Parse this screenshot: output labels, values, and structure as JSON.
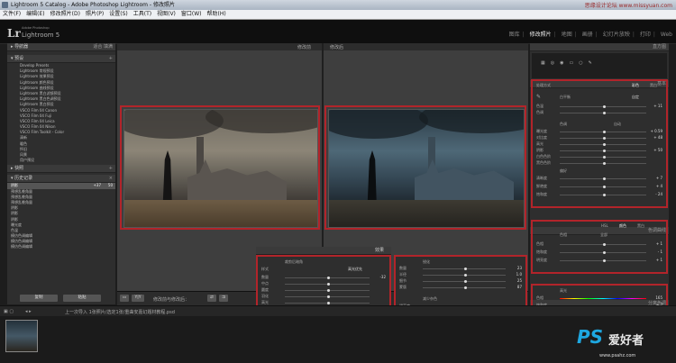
{
  "window": {
    "title": "Lightroom 5 Catalog - Adobe Photoshop Lightroom - 修改照片"
  },
  "menu": [
    "文件(F)",
    "编辑(E)",
    "修改照片(D)",
    "照片(P)",
    "设置(S)",
    "工具(T)",
    "视图(V)",
    "窗口(W)",
    "帮助(H)"
  ],
  "watermark_top": "思缘设计论坛 www.missyuan.com",
  "identity": {
    "logo": "Lr",
    "sub1": "Adobe Photoshop",
    "sub2": "Lightroom 5"
  },
  "modules": [
    "图库",
    "修改照片",
    "地图",
    "画册",
    "幻灯片放映",
    "打印",
    "Web"
  ],
  "left": {
    "navigator": {
      "title": "导航器",
      "options": [
        "适合",
        "填满"
      ]
    },
    "presets": {
      "title": "预设",
      "items": [
        "Develop Presets",
        "Lightroom 常规预设",
        "Lightroom 效果预设",
        "Lightroom 颜色预设",
        "Lightroom 曲线预设",
        "Lightroom 黑白滤镜预设",
        "Lightroom 黑白色调预设",
        "Lightroom 黑白预设",
        "VSCO Film 04 Canon",
        "VSCO Film 04 Fuji",
        "VSCO Film 04 Leica",
        "VSCO Film 04 Nikon",
        "VSCO Film Toolkit - Color",
        "清新",
        "暖色",
        "怀旧",
        "风景",
        "用户预设"
      ]
    },
    "snapshots": {
      "title": "快照"
    },
    "history": {
      "title": "历史记录",
      "items": [
        {
          "label": "阴影",
          "a": "+37",
          "b": "50"
        },
        {
          "label": "预想乱晚角量",
          "a": "",
          "b": ""
        },
        {
          "label": "预想乱晚角量",
          "a": "",
          "b": ""
        },
        {
          "label": "预想乱晚角量",
          "a": "",
          "b": ""
        },
        {
          "label": "阴影",
          "a": "",
          "b": ""
        },
        {
          "label": "阴影",
          "a": "",
          "b": ""
        },
        {
          "label": "阴影",
          "a": "",
          "b": ""
        },
        {
          "label": "曝光度",
          "a": "",
          "b": ""
        },
        {
          "label": "色温",
          "a": "",
          "b": ""
        },
        {
          "label": "模仿色调编辑",
          "a": "",
          "b": ""
        },
        {
          "label": "模仿色调编辑",
          "a": "",
          "b": ""
        },
        {
          "label": "模仿色调编辑",
          "a": "",
          "b": ""
        }
      ]
    },
    "copy_button": "复制",
    "paste_button": "粘贴"
  },
  "center": {
    "before_label": "修改前",
    "after_label": "修改后"
  },
  "toolbar": {
    "yy": "Y|Y",
    "mode": "修改前与修改后："
  },
  "effects": {
    "title": "效果",
    "vignette": {
      "section": "裁剪后暗角",
      "style_label": "样式",
      "style_value": "高光优先",
      "sliders": [
        {
          "label": "数量",
          "value": "-32"
        },
        {
          "label": "中点",
          "value": ""
        },
        {
          "label": "圆度",
          "value": ""
        },
        {
          "label": "羽化",
          "value": ""
        },
        {
          "label": "高光",
          "value": ""
        }
      ]
    },
    "grain": {
      "section": "颗粒",
      "sliders": [
        {
          "label": "数量",
          "value": ""
        },
        {
          "label": "大小",
          "value": ""
        },
        {
          "label": "粗糙度",
          "value": ""
        }
      ]
    },
    "footer": "细节控制"
  },
  "detail": {
    "sharpen": {
      "section": "锐化",
      "sliders": [
        {
          "label": "数量",
          "value": "23"
        },
        {
          "label": "半径",
          "value": "1.0"
        },
        {
          "label": "细节",
          "value": "25"
        },
        {
          "label": "蒙版",
          "value": "87"
        }
      ]
    },
    "noise": {
      "section": "减少杂色",
      "sliders": [
        {
          "label": "明亮度",
          "value": ""
        },
        {
          "label": "细节",
          "value": ""
        },
        {
          "label": "对比度",
          "value": ""
        },
        {
          "label": "颜色",
          "value": ""
        },
        {
          "label": "细节",
          "value": ""
        }
      ]
    },
    "footer": "镜头校正"
  },
  "right": {
    "histogram": "直方图",
    "basic": {
      "title": "基本",
      "treatment_label": "处理方式",
      "treatment_options": [
        "彩色",
        "黑白"
      ],
      "wb_label": "白平衡",
      "wb_value": "自定",
      "wb_sliders": [
        {
          "label": "色温",
          "value": "+ 11"
        },
        {
          "label": "色调",
          "value": ""
        }
      ],
      "tone_title": "色调",
      "tone_auto": "自动",
      "tone_sliders": [
        {
          "label": "曝光度",
          "value": "+ 0.59"
        },
        {
          "label": "对比度",
          "value": "+ 48"
        },
        {
          "label": "高光",
          "value": ""
        },
        {
          "label": "阴影",
          "value": "+ 50"
        },
        {
          "label": "白色色阶",
          "value": ""
        },
        {
          "label": "黑色色阶",
          "value": ""
        }
      ],
      "presence_title": "偏好",
      "presence_sliders": [
        {
          "label": "清晰度",
          "value": "+ 7"
        },
        {
          "label": "鲜艳度",
          "value": "+ 4"
        },
        {
          "label": "饱和度",
          "value": "- 24"
        }
      ]
    },
    "curve": "色调曲线",
    "hsl": {
      "tabs": [
        "HSL",
        "颜色",
        "黑白"
      ],
      "sub": "色相",
      "sub2": "饱和度",
      "sub3": "明亮度",
      "all": "全部",
      "sliders": [
        {
          "label": "色相",
          "value": "+ 1"
        },
        {
          "label": "饱和度",
          "value": "- 1"
        },
        {
          "label": "明亮度",
          "value": "+ 1"
        }
      ]
    },
    "split": {
      "title": "分离色调",
      "highlight": "高光",
      "hue": "色相",
      "hue_val": "165",
      "sat": "饱和度",
      "sat_val": "+ 7",
      "balance": "平衡",
      "shadows": "阴影",
      "shadow_hue": "色相",
      "shadow_hue_val": "none"
    }
  },
  "filmstrip": {
    "nav": "上一次导入 1张照片/选定1张/重曲安嘉幻题材教程.psd"
  },
  "watermark_bottom": {
    "ps": "PS",
    "site": "爱好者",
    "url": "www.psahz.com"
  },
  "colors": {
    "accent": "#b2242a",
    "panel": "#2e2e2e",
    "bg": "#1d1d1d"
  }
}
